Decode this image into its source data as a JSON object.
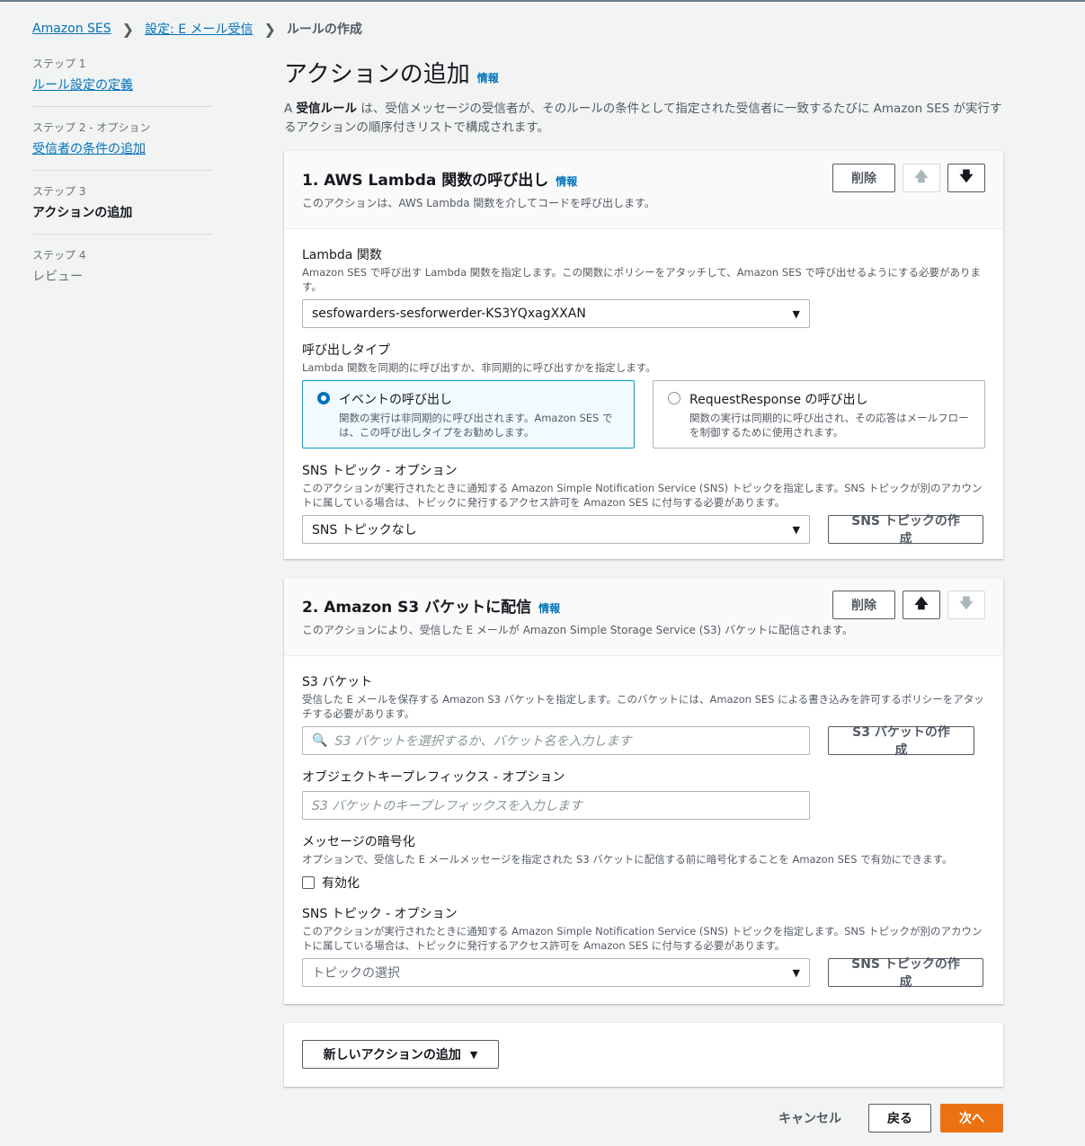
{
  "breadcrumb": {
    "home": "Amazon SES",
    "settings": "設定: E メール受信",
    "current": "ルールの作成"
  },
  "steps": [
    {
      "label": "ステップ 1",
      "title": "ルール設定の定義"
    },
    {
      "label": "ステップ 2 - オプション",
      "title": "受信者の条件の追加"
    },
    {
      "label": "ステップ 3",
      "title": "アクションの追加"
    },
    {
      "label": "ステップ 4",
      "title": "レビュー"
    }
  ],
  "page": {
    "title": "アクションの追加",
    "info": "情報",
    "desc_prefix": "A ",
    "desc_bold": "受信ルール",
    "desc_rest": " は、受信メッセージの受信者が、そのルールの条件として指定された受信者に一致するたびに Amazon SES が実行するアクションの順序付きリストで構成されます。"
  },
  "action1": {
    "title": "1. AWS Lambda 関数の呼び出し",
    "info": "情報",
    "desc": "このアクションは、AWS Lambda 関数を介してコードを呼び出します。",
    "delete": "削除",
    "lambda_label": "Lambda 関数",
    "lambda_desc": "Amazon SES で呼び出す Lambda 関数を指定します。この関数にポリシーをアタッチして、Amazon SES で呼び出せるようにする必要があります。",
    "lambda_value": "sesfowarders-sesforwerder-KS3YQxagXXAN",
    "invoke_label": "呼び出しタイプ",
    "invoke_desc": "Lambda 関数を同期的に呼び出すか、非同期的に呼び出すかを指定します。",
    "event_title": "イベントの呼び出し",
    "event_desc": "関数の実行は非同期的に呼び出されます。Amazon SES では、この呼び出しタイプをお勧めします。",
    "rr_title": "RequestResponse の呼び出し",
    "rr_desc": "関数の実行は同期的に呼び出され、その応答はメールフローを制御するために使用されます。",
    "sns_label": "SNS トピック - オプション",
    "sns_desc": "このアクションが実行されたときに通知する Amazon Simple Notification Service (SNS) トピックを指定します。SNS トピックが別のアカウントに属している場合は、トピックに発行するアクセス許可を Amazon SES に付与する必要があります。",
    "sns_value": "SNS トピックなし",
    "sns_create": "SNS トピックの作成"
  },
  "action2": {
    "title": "2. Amazon S3 バケットに配信",
    "info": "情報",
    "desc": "このアクションにより、受信した E メールが Amazon Simple Storage Service (S3) バケットに配信されます。",
    "delete": "削除",
    "s3_label": "S3 バケット",
    "s3_desc": "受信した E メールを保存する Amazon S3 バケットを指定します。このバケットには、Amazon SES による書き込みを許可するポリシーをアタッチする必要があります。",
    "s3_placeholder": "S3 バケットを選択するか、バケット名を入力します",
    "s3_create": "S3 バケットの作成",
    "prefix_label": "オブジェクトキープレフィックス - オプション",
    "prefix_placeholder": "S3 バケットのキープレフィックスを入力します",
    "enc_label": "メッセージの暗号化",
    "enc_desc": "オプションで、受信した E メールメッセージを指定された S3 バケットに配信する前に暗号化することを Amazon SES で有効にできます。",
    "enc_checkbox": "有効化",
    "sns_label": "SNS トピック - オプション",
    "sns_desc": "このアクションが実行されたときに通知する Amazon Simple Notification Service (SNS) トピックを指定します。SNS トピックが別のアカウントに属している場合は、トピックに発行するアクセス許可を Amazon SES に付与する必要があります。",
    "sns_placeholder": "トピックの選択",
    "sns_create": "SNS トピックの作成"
  },
  "add_action": "新しいアクションの追加",
  "footer": {
    "cancel": "キャンセル",
    "back": "戻る",
    "next": "次へ"
  },
  "colors": {
    "link": "#0073bb",
    "primary": "#ec7211",
    "selected_border": "#00a1c9"
  }
}
